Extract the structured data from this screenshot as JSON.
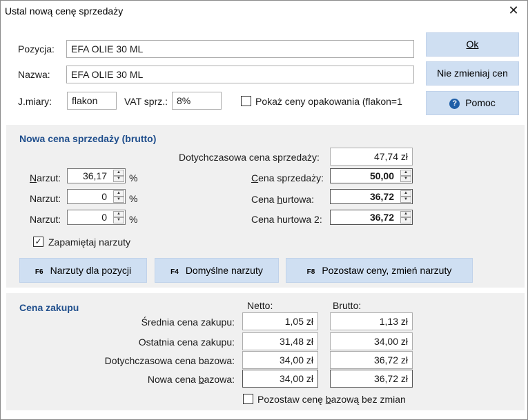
{
  "window": {
    "title": "Ustal nową cenę sprzedaży"
  },
  "top": {
    "pozycja_label": "Pozycja:",
    "pozycja_value": "EFA OLIE  30 ML",
    "nazwa_label": "Nazwa:",
    "nazwa_value": "EFA OLIE  30 ML",
    "jmiary_label": "J.miary:",
    "jmiary_value": "flakon",
    "vat_label": "VAT sprz.:",
    "vat_value": "8%",
    "pokaz_label": "Pokaż ceny opakowania (flakon=1"
  },
  "buttons": {
    "ok": "Ok",
    "nie_zmieniaj": "Nie zmieniaj cen",
    "pomoc": "Pomoc"
  },
  "nowa_cena": {
    "title": "Nowa cena sprzedaży (brutto)",
    "dotychczasowa_label": "Dotychczasowa cena sprzedaży:",
    "dotychczasowa_value": "47,74 zł",
    "narzut_label": "Narzut:",
    "narzut1": "36,17",
    "narzut2": "0",
    "narzut3": "0",
    "percent": "%",
    "cena_sprzedazy_label": "Cena sprzedaży:",
    "cena_sprzedazy_value": "50,00",
    "cena_hurtowa_label": "Cena hurtowa:",
    "cena_hurtowa_value": "36,72",
    "cena_hurtowa2_label": "Cena hurtowa 2:",
    "cena_hurtowa2_value": "36,72",
    "zapamietaj_label": "Zapamiętaj narzuty",
    "f6_key": "F6",
    "f6_label": "Narzuty dla pozycji",
    "f4_key": "F4",
    "f4_label": "Domyślne narzuty",
    "f8_key": "F8",
    "f8_label": "Pozostaw ceny, zmień narzuty"
  },
  "cena_zakupu": {
    "title": "Cena zakupu",
    "netto_header": "Netto:",
    "brutto_header": "Brutto:",
    "rows": [
      {
        "label": "Średnia cena zakupu:",
        "netto": "1,05 zł",
        "brutto": "1,13 zł"
      },
      {
        "label": "Ostatnia cena zakupu:",
        "netto": "31,48 zł",
        "brutto": "34,00 zł"
      },
      {
        "label": "Dotychczasowa cena bazowa:",
        "netto": "34,00 zł",
        "brutto": "36,72 zł"
      },
      {
        "label": "Nowa cena bazowa:",
        "netto": "34,00 zł",
        "brutto": "36,72 zł"
      }
    ],
    "pozostaw_label": "Pozostaw cenę bazową bez zmian"
  },
  "colors": {
    "button_bg": "#cfdff2",
    "section_title": "#1f4e8c",
    "panel_bg": "#f0f0f0"
  },
  "icons": {
    "close": "close-icon",
    "help": "help-icon",
    "check": "check-icon"
  }
}
